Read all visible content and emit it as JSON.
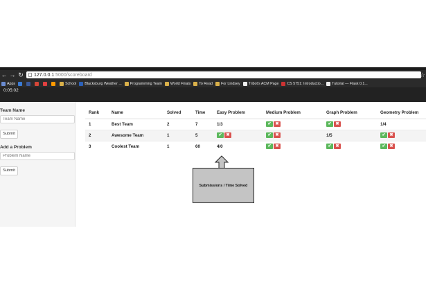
{
  "browser": {
    "url_host": "127.0.0.1",
    "url_path": ":5000/scoreboard",
    "bookmarks": [
      {
        "label": "Apps",
        "color": "#6a8bd0"
      },
      {
        "label": "",
        "color": "#3a7bd5"
      },
      {
        "label": "",
        "color": "#3b5998"
      },
      {
        "label": "",
        "color": "#d44638"
      },
      {
        "label": "",
        "color": "#e04040"
      },
      {
        "label": "",
        "color": "#ff9900"
      },
      {
        "label": "School",
        "color": "#d9b04a"
      },
      {
        "label": "Blacksburg Weather ...",
        "color": "#2b60b8"
      },
      {
        "label": "Programming Team",
        "color": "#d9b04a"
      },
      {
        "label": "World Finals",
        "color": "#d9b04a"
      },
      {
        "label": "To Read",
        "color": "#d9b04a"
      },
      {
        "label": "For Lindsey",
        "color": "#d9b04a"
      },
      {
        "label": "Tribot's ACM Page",
        "color": "#eeeeee"
      },
      {
        "label": "CS 5751: Introductio...",
        "color": "#cc3333"
      },
      {
        "label": "Tutorial — Flask 0.1...",
        "color": "#eeeeee"
      }
    ]
  },
  "navbar": {
    "timer": "0:05:02"
  },
  "sidebar": {
    "team_name_label": "Team Name",
    "team_name_placeholder": "Team Name",
    "submit_label": "Submit",
    "add_problem_label": "Add a Problem",
    "problem_name_placeholder": "Problem Name",
    "submit2_label": "Submit"
  },
  "scoreboard": {
    "columns": [
      "Rank",
      "Name",
      "Solved",
      "Time",
      "Easy Problem",
      "Medium Problem",
      "Graph Problem",
      "Geometry Problem"
    ],
    "rows": [
      {
        "rank": "1",
        "name": "Best Team",
        "solved": "2",
        "time": "7",
        "easy": "1/3",
        "medium": "buttons",
        "graph": "buttons",
        "geometry": "1/4"
      },
      {
        "rank": "2",
        "name": "Awesome Team",
        "solved": "1",
        "time": "5",
        "easy": "buttons",
        "medium": "buttons",
        "graph": "1/5",
        "geometry": "buttons"
      },
      {
        "rank": "3",
        "name": "Coolest Team",
        "solved": "1",
        "time": "60",
        "easy": "4/0",
        "medium": "buttons",
        "graph": "buttons",
        "geometry": "buttons"
      }
    ],
    "ok_glyph": "✔",
    "no_glyph": "✖"
  },
  "annotation": {
    "text": "Submissions / Time Solved"
  }
}
